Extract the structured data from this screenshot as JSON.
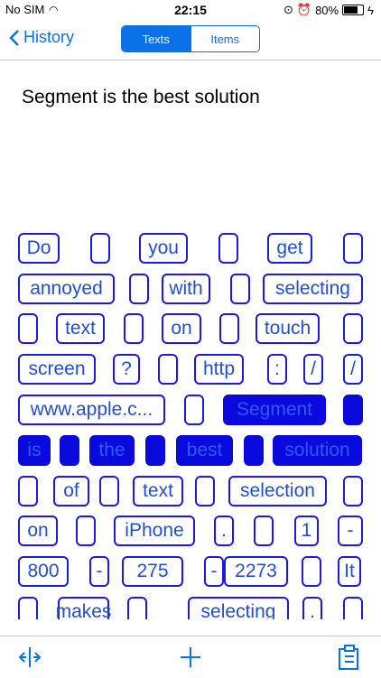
{
  "status": {
    "carrier": "No SIM",
    "time": "22:15",
    "battery": "80%",
    "battery_level": 0.8
  },
  "nav": {
    "back_label": "History",
    "tab_texts": "Texts",
    "tab_items": "Items"
  },
  "sentence": "Segment is the best solution",
  "tokens": [
    "Do",
    "",
    "you",
    "",
    "get",
    "",
    "annoyed",
    "",
    "with",
    "",
    "selecting",
    "",
    "text",
    "",
    "on",
    "",
    "touch",
    "",
    "screen",
    "?",
    "",
    "http",
    ":",
    "/",
    "/",
    "www.apple.c...",
    "",
    "Segment",
    "",
    "is",
    "",
    "the",
    "",
    "best",
    "",
    "solution",
    "",
    "of",
    "",
    "text",
    "",
    "selection",
    "",
    "on",
    "",
    "iPhone",
    ".",
    "",
    "1",
    "-",
    "800",
    "-",
    "275",
    "-",
    "2273",
    "",
    "It",
    "",
    "makes",
    "",
    "selecting",
    ".",
    ""
  ],
  "selected": [
    27,
    28,
    29,
    30,
    31,
    32,
    33,
    34,
    35
  ],
  "colors": {
    "accent": "#0a72e6",
    "token_border": "#1a1ae0",
    "selected_fill": "#0a0adf"
  },
  "toolbar": {
    "left_icon": "split-icon",
    "center_icon": "plus-icon",
    "right_icon": "clipboard-icon"
  }
}
